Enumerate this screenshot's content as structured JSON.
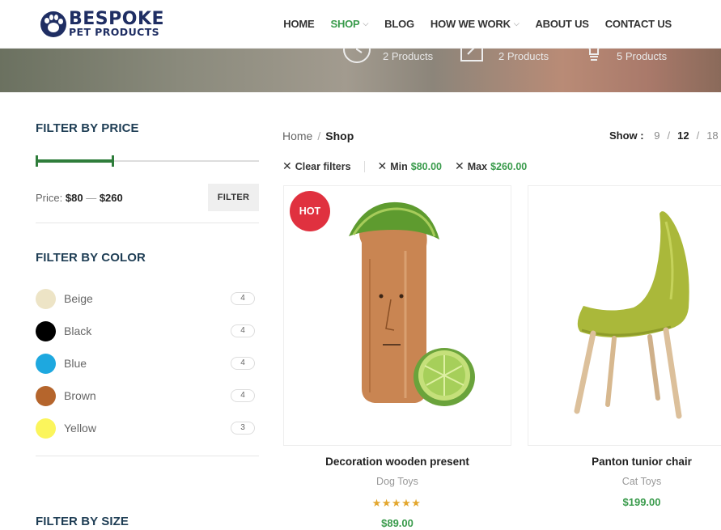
{
  "brand": {
    "name_line1": "BESPOKE",
    "name_line2": "PET PRODUCTS",
    "color": "#1f2e63"
  },
  "nav": {
    "items": [
      {
        "label": "HOME"
      },
      {
        "label": "SHOP",
        "has_dropdown": true
      },
      {
        "label": "BLOG"
      },
      {
        "label": "HOW WE WORK",
        "has_dropdown": true
      },
      {
        "label": "ABOUT US"
      },
      {
        "label": "CONTACT US"
      }
    ],
    "active_color": "#3a9b4c"
  },
  "hero": {
    "categories": [
      {
        "count": "2 Products",
        "icon": "clock-icon"
      },
      {
        "count": "2 Products",
        "icon": "pencil-icon"
      },
      {
        "count": "5 Products",
        "icon": "lightbulb-icon"
      }
    ]
  },
  "sidebar": {
    "price_title": "FILTER BY PRICE",
    "price_range": {
      "min": 80,
      "max": 260,
      "label_prefix": "Price:",
      "min_label": "$80",
      "dash": "—",
      "max_label": "$260",
      "fill_start_fraction": 0.0,
      "fill_end_fraction": 0.35
    },
    "filter_button": "FILTER",
    "color_title": "FILTER BY COLOR",
    "colors": [
      {
        "name": "Beige",
        "count": "4",
        "hex": "#ede4c6"
      },
      {
        "name": "Black",
        "count": "4",
        "hex": "#000000"
      },
      {
        "name": "Blue",
        "count": "4",
        "hex": "#1ea8df"
      },
      {
        "name": "Brown",
        "count": "4",
        "hex": "#b5652c"
      },
      {
        "name": "Yellow",
        "count": "3",
        "hex": "#fbf55c"
      }
    ],
    "size_title": "FILTER BY SIZE"
  },
  "breadcrumb": {
    "home": "Home",
    "sep": "/",
    "current": "Shop"
  },
  "show": {
    "label": "Show :",
    "options": [
      "9",
      "12",
      "18"
    ],
    "selected": "12",
    "sep": "/"
  },
  "active_filters": {
    "clear_label": "Clear filters",
    "min_label": "Min",
    "min_value": "$80.00",
    "max_label": "Max",
    "max_value": "$260.00"
  },
  "products": [
    {
      "name": "Decoration wooden present",
      "category": "Dog Toys",
      "price": "$89.00",
      "badge": "HOT",
      "rating": 5,
      "rating_stars": "★★★★★"
    },
    {
      "name": "Panton tunior chair",
      "category": "Cat Toys",
      "price": "$199.00"
    }
  ]
}
